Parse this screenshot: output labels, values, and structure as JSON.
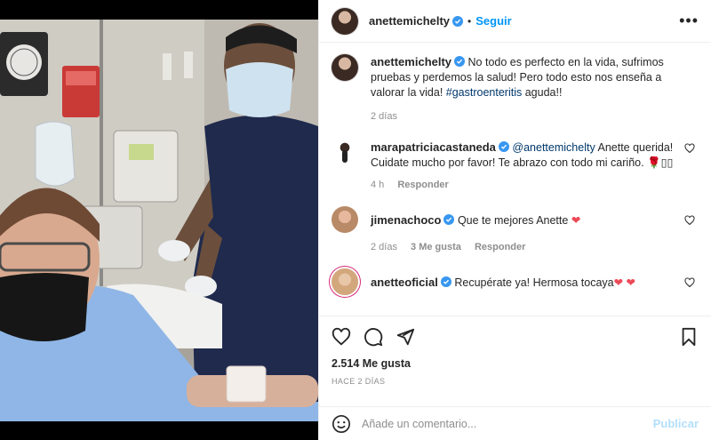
{
  "post": {
    "author": "anettemichelty",
    "follow_label": "Seguir",
    "dot": "•",
    "more_label": "•••",
    "caption_author": "anettemichelty",
    "caption_text": "No todo es perfecto en la vida, sufrimos pruebas y perdemos la salud! Pero todo esto nos enseña a valorar la vida!",
    "caption_hashtag": "#gastroenteritis",
    "caption_tail": " aguda!!",
    "caption_time": "2 días"
  },
  "comments": [
    {
      "user": "marapatriciacastaneda",
      "mention": "@anettemichelty",
      "text": " Anette querida! Cuidate mucho por favor! Te abrazo con todo mi cariño. 🌹▯▯",
      "time": "4 h",
      "reply": "Responder"
    },
    {
      "user": "jimenachoco",
      "text": "Que te mejores Anette ",
      "emoji": "❤",
      "time": "2 días",
      "likes": "3 Me gusta",
      "reply": "Responder"
    },
    {
      "user": "anetteoficial",
      "text": "Recupérate ya! Hermosa tocaya",
      "emoji": "❤ ❤"
    }
  ],
  "stats": {
    "likes": "2.514 Me gusta",
    "time": "Hace 2 días"
  },
  "composer": {
    "placeholder": "Añade un comentario...",
    "publish_label": "Publicar"
  },
  "colors": {
    "accent": "#0095f6",
    "verified": "#3897f0",
    "heart": "#ed4956"
  },
  "icons": [
    "verified-icon",
    "more-icon",
    "heart-icon",
    "comment-icon",
    "share-icon",
    "bookmark-icon",
    "emoji-icon"
  ]
}
